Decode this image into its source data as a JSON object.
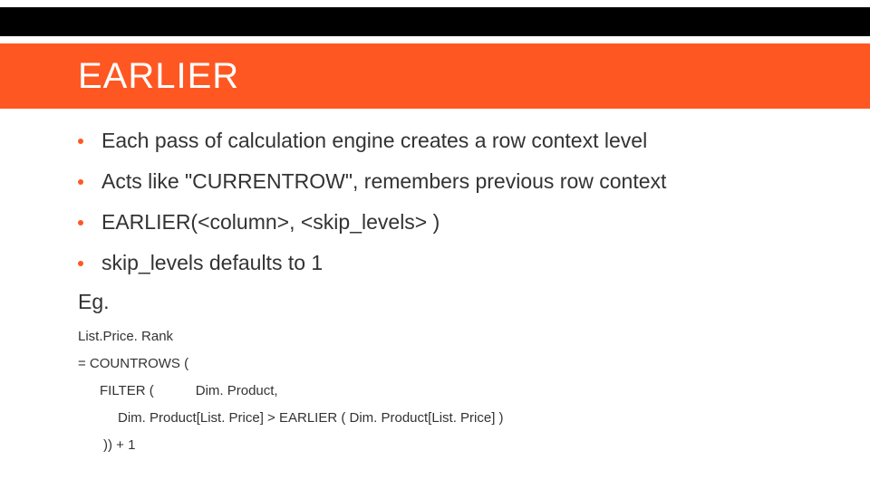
{
  "title": "EARLIER",
  "bullets": [
    "Each pass of calculation engine creates a row context level",
    "Acts like \"CURRENTROW\", remembers previous row context",
    "EARLIER(<column>, <skip_levels> )",
    "skip_levels defaults to 1"
  ],
  "eg_label": "Eg.",
  "code": {
    "line1": "List.Price. Rank",
    "line2": "= COUNTROWS (",
    "line3a": "FILTER (",
    "line3b": "Dim. Product,",
    "line4": "Dim. Product[List. Price] > EARLIER ( Dim. Product[List. Price] )",
    "line5": ")) + 1"
  }
}
